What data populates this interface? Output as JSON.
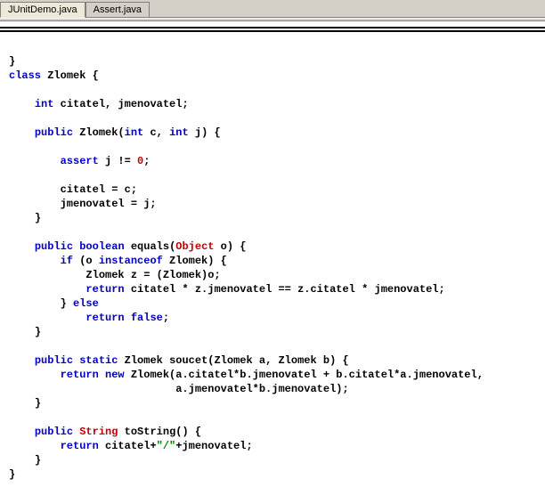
{
  "tabs": [
    {
      "label": "JUnitDemo.java",
      "active": true
    },
    {
      "label": "Assert.java",
      "active": false
    }
  ],
  "code": {
    "l0": "}",
    "kw_class": "class",
    "class_name": " Zlomek {",
    "kw_int": "int",
    "field_decl": " citatel, jmenovatel;",
    "kw_public": "public",
    "ctor_name": " Zlomek(",
    "kw_int2": "int",
    "ctor_mid": " c, ",
    "kw_int3": "int",
    "ctor_end": " j) {",
    "kw_assert": "assert",
    "assert_expr": " j != ",
    "num_zero": "0",
    "semicolon": ";",
    "ctor_body1": "citatel = c;",
    "ctor_body2": "jmenovatel = j;",
    "close_brace": "}",
    "kw_boolean": "boolean",
    "eq_name": " equals(",
    "cls_object": "Object",
    "eq_param": " o) {",
    "kw_if": "if",
    "if_cond_open": " (o ",
    "kw_instanceof": "instanceof",
    "if_cond_close": " Zlomek) {",
    "eq_body1": "Zlomek z = (Zlomek)o;",
    "kw_return": "return",
    "eq_ret": " citatel * z.jmenovatel == z.citatel * jmenovatel;",
    "kw_else": "else",
    "else_open": "} ",
    "kw_false": "false",
    "kw_static": "static",
    "soucet_sig": " Zlomek soucet(Zlomek a, Zlomek b) {",
    "kw_new": "new",
    "soucet_ret1": " Zlomek(a.citatel*b.jmenovatel + b.citatel*a.jmenovatel,",
    "soucet_ret2": "a.jmenovatel*b.jmenovatel);",
    "cls_string": "String",
    "tostr_sig": " toString() {",
    "tostr_ret1": " citatel+",
    "str_slash": "\"/\"",
    "tostr_ret2": "+jmenovatel;"
  }
}
